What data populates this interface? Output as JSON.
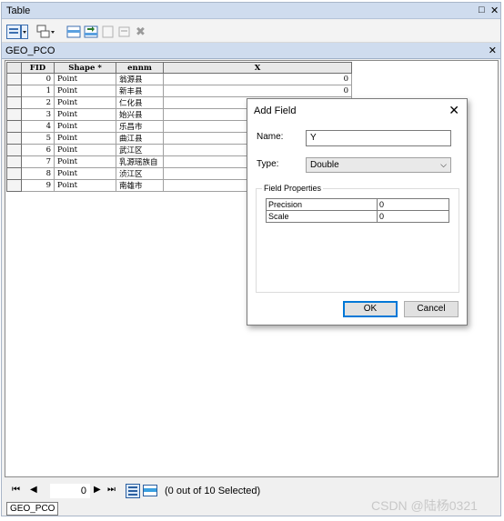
{
  "window": {
    "title": "Table",
    "restore_glyph": "□",
    "close_glyph": "✕"
  },
  "toolbar": {
    "icons": [
      "table-options-icon",
      "related-tables-icon",
      "select-by-attributes-icon",
      "switch-selection-icon",
      "clear-selection-icon",
      "delete-selected-icon"
    ],
    "delete_glyph": "✖"
  },
  "tab": {
    "label": "GEO_PCO",
    "close_glyph": "✕"
  },
  "grid": {
    "headers": [
      "FID",
      "Shape *",
      "ennm",
      "X"
    ],
    "rows": [
      {
        "fid": "0",
        "shape": "Point",
        "ennm": "翁源县",
        "x": "0"
      },
      {
        "fid": "1",
        "shape": "Point",
        "ennm": "新丰县",
        "x": "0"
      },
      {
        "fid": "2",
        "shape": "Point",
        "ennm": "仁化县",
        "x": ""
      },
      {
        "fid": "3",
        "shape": "Point",
        "ennm": "始兴县",
        "x": ""
      },
      {
        "fid": "4",
        "shape": "Point",
        "ennm": "乐昌市",
        "x": ""
      },
      {
        "fid": "5",
        "shape": "Point",
        "ennm": "曲江县",
        "x": ""
      },
      {
        "fid": "6",
        "shape": "Point",
        "ennm": "武江区",
        "x": ""
      },
      {
        "fid": "7",
        "shape": "Point",
        "ennm": "乳源瑶族自",
        "x": ""
      },
      {
        "fid": "8",
        "shape": "Point",
        "ennm": "浈江区",
        "x": ""
      },
      {
        "fid": "9",
        "shape": "Point",
        "ennm": "南雄市",
        "x": ""
      }
    ]
  },
  "dialog": {
    "title": "Add Field",
    "close_glyph": "✕",
    "name_label": "Name:",
    "name_value": "Y",
    "type_label": "Type:",
    "type_value": "Double",
    "type_arrow": "⌵",
    "properties_label": "Field Properties",
    "properties": [
      {
        "name": "Precision",
        "value": "0"
      },
      {
        "name": "Scale",
        "value": "0"
      }
    ],
    "ok_label": "OK",
    "cancel_label": "Cancel"
  },
  "status": {
    "first_glyph": "⏮",
    "prev_glyph": "◀",
    "next_glyph": "▶",
    "last_glyph": "⏭",
    "record": "0",
    "selection_text": "(0 out of 10 Selected)",
    "view_icons": [
      "show-all-records-icon",
      "show-selected-records-icon"
    ]
  },
  "bottom_tab": {
    "label": "GEO_PCO"
  },
  "watermark": {
    "text": "CSDN @陆杨0321"
  },
  "colors": {
    "titlebar": "#cfdcee",
    "accent": "#0078d7",
    "window_bg": "#f0f0f0"
  }
}
